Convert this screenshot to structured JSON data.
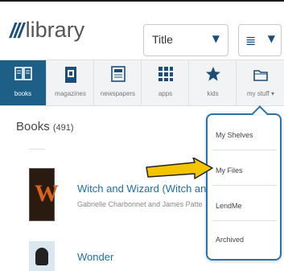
{
  "header": {
    "logo_mark": "///",
    "logo_text": "library",
    "sort_value": "Title",
    "sort_arrow": "▼",
    "view_icon": "≣",
    "view_arrow": "▼"
  },
  "nav": {
    "tabs": [
      {
        "label": "books",
        "icon": "book-icon",
        "glyph": "📖",
        "active": true
      },
      {
        "label": "magazines",
        "icon": "magazine-icon",
        "glyph": "▣"
      },
      {
        "label": "newspapers",
        "icon": "newspaper-icon",
        "glyph": "▤"
      },
      {
        "label": "apps",
        "icon": "apps-grid-icon",
        "glyph": "▦"
      },
      {
        "label": "kids",
        "icon": "star-icon",
        "glyph": "★"
      },
      {
        "label": "my stuff ▾",
        "icon": "folder-icon",
        "glyph": "🗀"
      }
    ]
  },
  "content": {
    "section_title": "Books",
    "count": "(491)",
    "books": [
      {
        "title": "Witch and Wizard (Witch and",
        "author": "Gabrielle Charbonnet and James Patte",
        "cover_letter": "W"
      },
      {
        "title": "Wonder",
        "author": ""
      }
    ]
  },
  "menu": {
    "items": [
      "My Shelves",
      "My Files",
      "LendMe",
      "Archived"
    ]
  },
  "colors": {
    "accent": "#1d5f86",
    "link": "#1d6fa5",
    "menu_border": "#2b73a6",
    "arrow": "#f5c400"
  }
}
